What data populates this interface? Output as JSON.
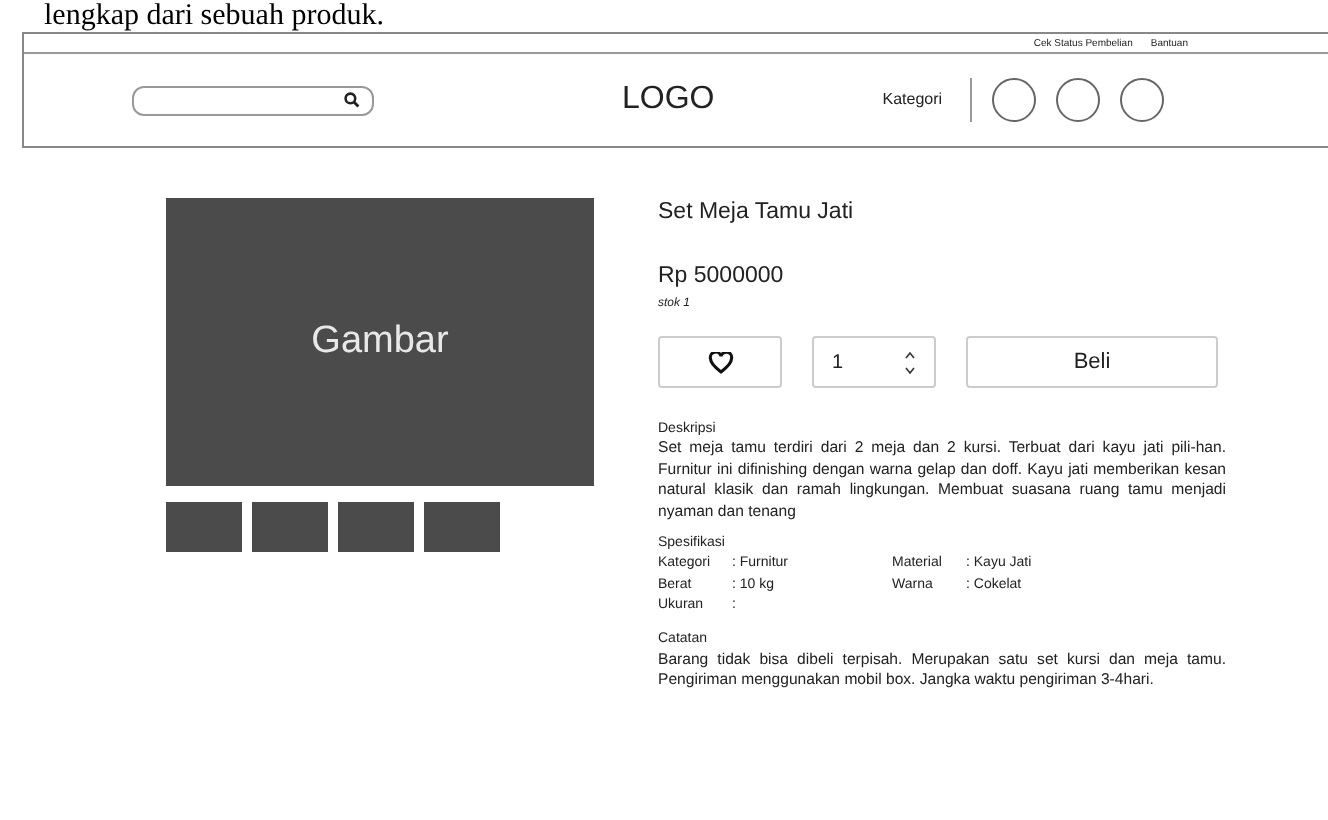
{
  "document_text": "lengkap dari sebuah produk.",
  "top_links": [
    "Cek Status Pembelian",
    "Bantuan"
  ],
  "header": {
    "logo": "LOGO",
    "menu": "Kategori"
  },
  "gallery": {
    "main_label": "Gambar"
  },
  "product": {
    "title": "Set Meja Tamu Jati",
    "price": "Rp 5000000",
    "stock": "stok 1",
    "quantity": "1",
    "buy_button": "Beli"
  },
  "description": {
    "heading": "Deskripsi",
    "text": "Set meja tamu terdiri dari 2 meja dan 2 kursi. Terbuat dari kayu jati pili-han. Furnitur ini difinishing dengan warna gelap dan doff. Kayu jati memberikan kesan natural klasik dan ramah lingkungan. Membuat suasana ruang tamu menjadi nyaman dan tenang"
  },
  "specs": {
    "heading": "Spesifikasi",
    "items": [
      {
        "label": "Kategori",
        "value": ": Furnitur"
      },
      {
        "label": "Material",
        "value": ": Kayu Jati"
      },
      {
        "label": "Berat",
        "value": ": 10 kg"
      },
      {
        "label": "Warna",
        "value": ": Cokelat"
      },
      {
        "label": "Ukuran",
        "value": ":"
      }
    ]
  },
  "notes": {
    "heading": "Catatan",
    "text": "Barang tidak bisa dibeli terpisah. Merupakan satu set kursi dan meja tamu. Pengiriman menggunakan mobil box. Jangka waktu pengiriman 3-4hari."
  }
}
